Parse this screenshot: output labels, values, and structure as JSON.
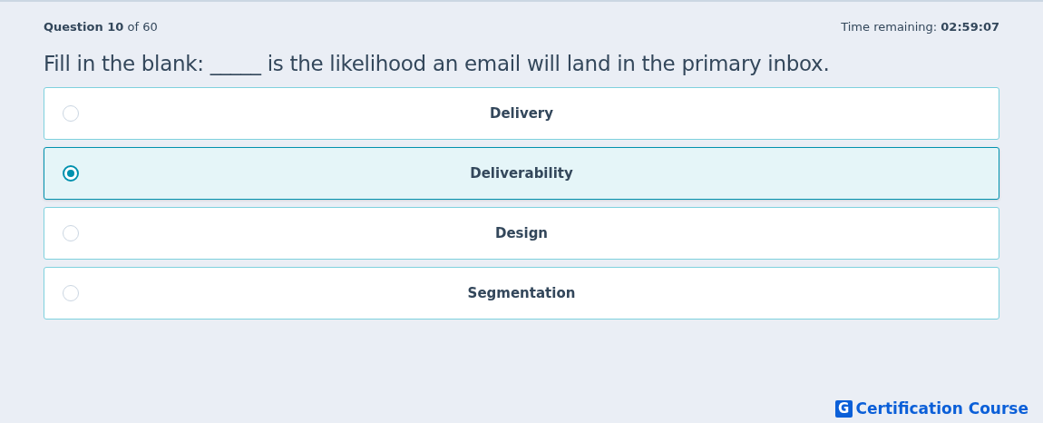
{
  "progress": "**Question 10** of 60",
  "timer": "Time remaining: **02:59:07**",
  "question": "Fill in the blank: _____ is the likelihood an email will land in the primary inbox.",
  "options": [
    {
      "label": "Delivery",
      "selected": false
    },
    {
      "label": "Deliverability",
      "selected": true
    },
    {
      "label": "Design",
      "selected": false
    },
    {
      "label": "Segmentation",
      "selected": false
    }
  ],
  "brand": {
    "mark": "G",
    "name": "Certification Course"
  }
}
